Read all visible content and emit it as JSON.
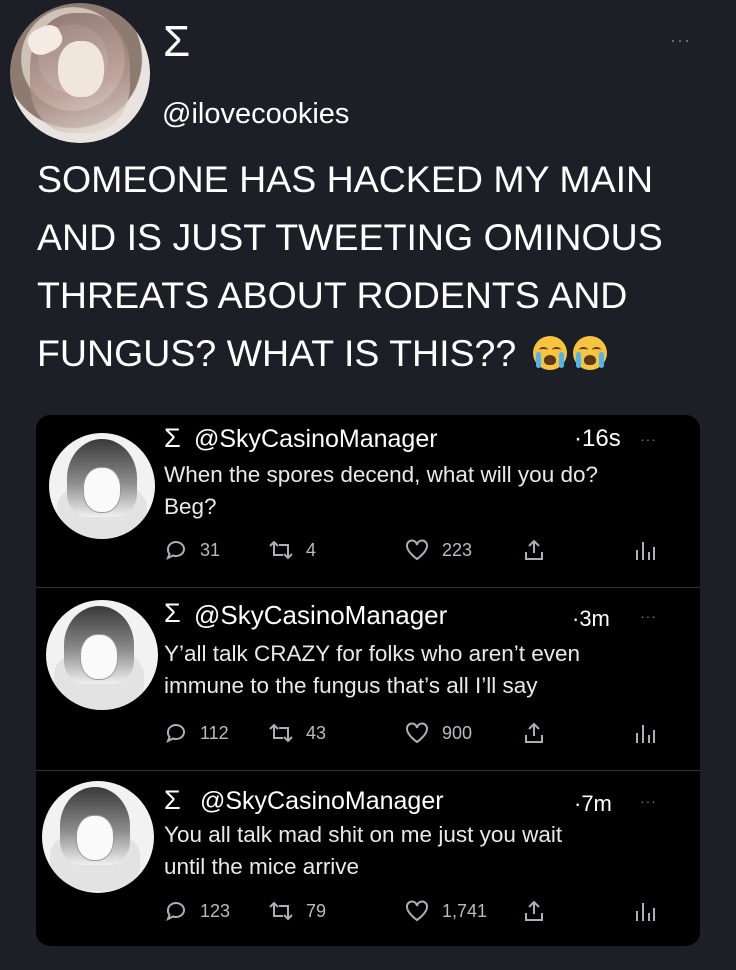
{
  "tweet": {
    "display_name": "Σ",
    "handle": "@ilovecookies",
    "more": "···",
    "text": "SOMEONE HAS HACKED MY MAIN AND IS JUST TWEETING OMINOUS THREATS ABOUT RODENTS AND FUNGUS? WHAT IS THIS??",
    "emoji": [
      "loudly-crying-face-icon",
      "loudly-crying-face-icon"
    ]
  },
  "replies": [
    {
      "sigma": "Σ",
      "handle": "@SkyCasinoManager",
      "time": "·16s",
      "more": "···",
      "line1": "When the spores decend, what will you do?",
      "line2": "Beg?",
      "replies": "31",
      "retweets": "4",
      "likes": "223"
    },
    {
      "sigma": "Σ",
      "handle": "@SkyCasinoManager",
      "time": "·3m",
      "more": "···",
      "line1": "Y’all talk CRAZY for folks who aren’t even",
      "line2": "immune to the fungus that’s all I’ll say",
      "replies": "112",
      "retweets": "43",
      "likes": "900"
    },
    {
      "sigma": "Σ",
      "handle": "@SkyCasinoManager",
      "time": "·7m",
      "more": "···",
      "line1": "You all talk mad shit on me just you wait",
      "line2": "until the mice arrive",
      "replies": "123",
      "retweets": "79",
      "likes": "1,741"
    }
  ],
  "colors": {
    "background": "#1c1f26",
    "card": "#000000",
    "muted": "#71767b",
    "text": "#e7e9ea"
  }
}
